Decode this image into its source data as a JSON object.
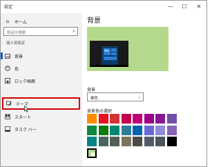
{
  "window": {
    "title": "設定",
    "min": "—",
    "max": "☐",
    "close": "✕"
  },
  "sidebar": {
    "home": "ホーム",
    "search_placeholder": "設定の検索",
    "section": "個人用設定",
    "items": [
      {
        "label": "背景",
        "icon": "image-icon"
      },
      {
        "label": "色",
        "icon": "palette-icon"
      },
      {
        "label": "ロック画面",
        "icon": "lock-screen-icon"
      },
      {
        "label": "テーマ",
        "icon": "theme-icon"
      },
      {
        "label": "スタート",
        "icon": "start-icon"
      },
      {
        "label": "タスク バー",
        "icon": "taskbar-icon"
      }
    ]
  },
  "main": {
    "title": "背景",
    "preview_sample": "Aa",
    "background_label": "背景",
    "background_value": "単色",
    "color_label": "背景色の選択"
  },
  "colors": {
    "accent": "#0a5fbf",
    "highlight": "#d20000",
    "preview_bg": "#b4d98c",
    "swatches": [
      [
        "#ff8c00",
        "#e81123",
        "#d13438",
        "#c30052",
        "#bf0077",
        "#9a0089",
        "#881798",
        "#744da9"
      ],
      [
        "#10893e",
        "#107c10",
        "#018574",
        "#2d7d9a",
        "#0063b1",
        "#6b69d6",
        "#8e8cd8",
        "#8764b8"
      ],
      [
        "#038387",
        "#486860",
        "#525e54",
        "#7e735f",
        "#4c4a48",
        "#515c6b",
        "#4a5459",
        "#000000"
      ],
      [
        "#b4d98c"
      ]
    ],
    "selected": [
      3,
      0
    ]
  }
}
